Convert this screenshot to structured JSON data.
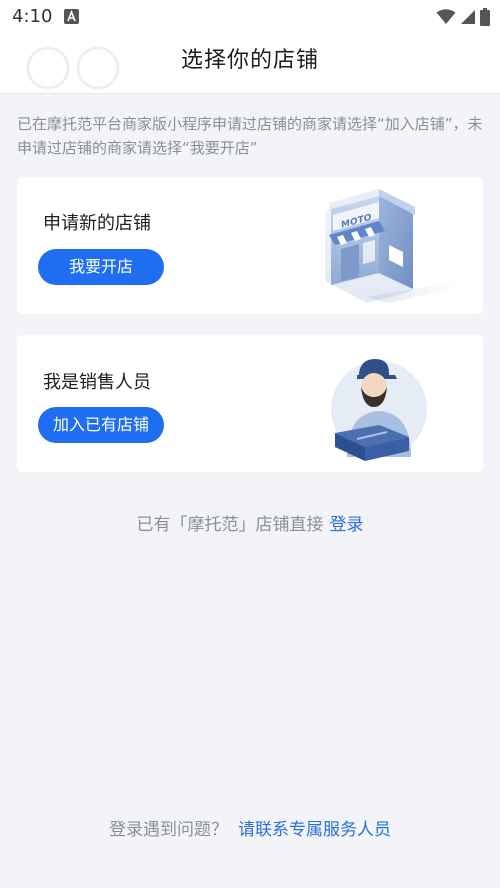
{
  "status_bar": {
    "time": "4:10"
  },
  "header": {
    "title": "选择你的店铺"
  },
  "intro_text": "已在摩托范平台商家版小程序申请过店铺的商家请选择“加入店铺”，未申请过店铺的商家请选择“我要开店”",
  "cards": [
    {
      "title": "申请新的店铺",
      "button_label": "我要开店",
      "illustration": "store-icon",
      "sign_text": "MOTO"
    },
    {
      "title": "我是销售人员",
      "button_label": "加入已有店铺",
      "illustration": "salesperson-icon"
    }
  ],
  "login": {
    "prefix": "已有「摩托范」店铺直接",
    "link_label": "登录"
  },
  "help": {
    "prefix": "登录遇到问题？",
    "link_label": "请联系专属服务人员"
  },
  "colors": {
    "primary": "#1f6ef2",
    "link": "#2b6fdc",
    "background": "#f3f4f7",
    "muted_text": "#8a8f99"
  }
}
